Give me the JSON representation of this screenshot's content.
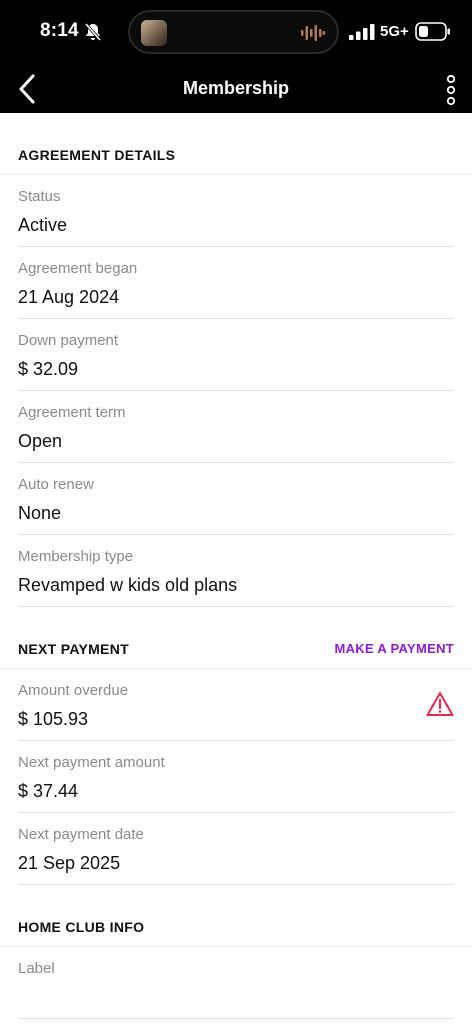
{
  "status_bar": {
    "time": "8:14",
    "network": "5G+",
    "icons": [
      "bell-slash-icon",
      "signal-bars-icon",
      "battery-icon",
      "audio-waveform-icon"
    ]
  },
  "nav": {
    "title": "Membership",
    "icons": [
      "chevron-left-icon",
      "more-vertical-icon"
    ]
  },
  "sections": {
    "agreement": {
      "title": "AGREEMENT DETAILS",
      "fields": [
        {
          "label": "Status",
          "value": "Active"
        },
        {
          "label": "Agreement began",
          "value": "21 Aug 2024"
        },
        {
          "label": "Down payment",
          "value": "$ 32.09"
        },
        {
          "label": "Agreement term",
          "value": "Open"
        },
        {
          "label": "Auto renew",
          "value": "None"
        },
        {
          "label": "Membership type",
          "value": "Revamped w kids old plans"
        }
      ]
    },
    "next_payment": {
      "title": "NEXT PAYMENT",
      "action": "MAKE A PAYMENT",
      "fields": [
        {
          "label": "Amount overdue",
          "value": "$ 105.93",
          "icon": "warning-triangle-icon"
        },
        {
          "label": "Next payment amount",
          "value": "$ 37.44"
        },
        {
          "label": "Next payment date",
          "value": "21 Sep 2025"
        }
      ]
    },
    "home_club": {
      "title": "HOME CLUB INFO",
      "fields": [
        {
          "label": "Label",
          "value": ""
        }
      ]
    }
  },
  "colors": {
    "accent": "#8a1cd8",
    "warning": "#e0294a",
    "header_bg": "#000000",
    "label_gray": "#8b8b8b"
  }
}
